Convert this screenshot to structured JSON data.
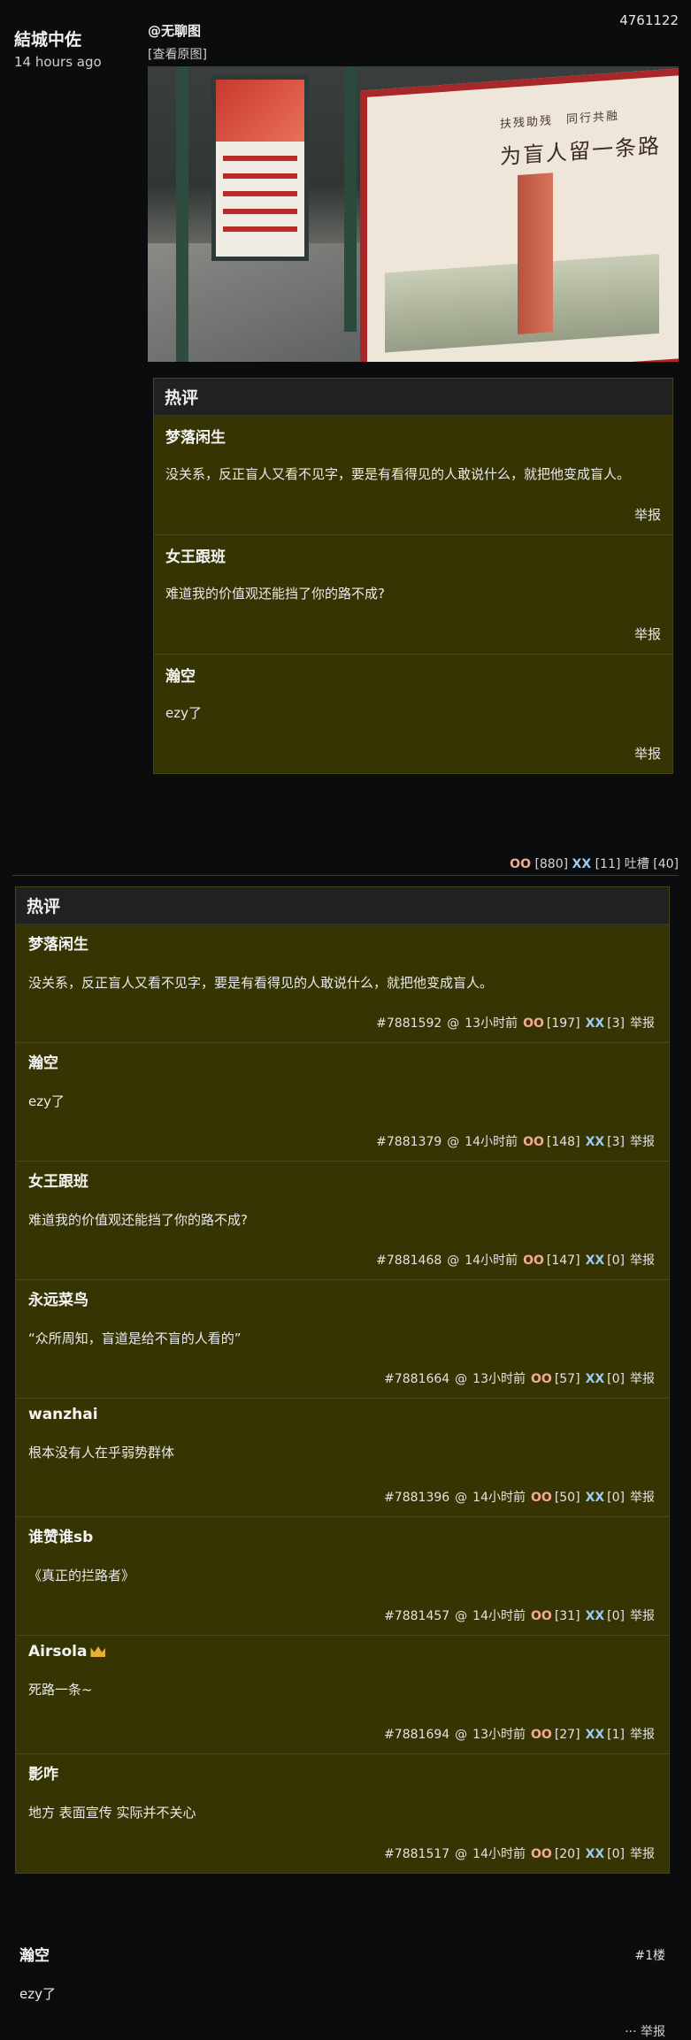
{
  "post": {
    "author": "結城中佐",
    "time": "14 hours ago",
    "id": "4761122",
    "source": "@无聊图",
    "view_original": "[查看原图]",
    "image_slogan_top": "扶残助残　同行共融",
    "image_slogan_main": "为盲人留一条路"
  },
  "hot_inline": {
    "title": "热评",
    "comments": [
      {
        "name": "梦落闲生",
        "text": "没关系，反正盲人又看不见字，要是有看得见的人敢说什么，就把他变成盲人。",
        "report": "举报"
      },
      {
        "name": "女王跟班",
        "text": "难道我的价值观还能挡了你的路不成?",
        "report": "举报"
      },
      {
        "name": "瀚空",
        "text": "ezy了",
        "report": "举报"
      }
    ]
  },
  "post_votes": {
    "oo_label": "OO",
    "oo_count": "[880]",
    "xx_label": "XX",
    "xx_count": "[11]",
    "tucao_label": "吐槽",
    "tucao_count": "[40]"
  },
  "hot_list": {
    "title": "热评",
    "comments": [
      {
        "name": "梦落闲生",
        "text": "没关系，反正盲人又看不见字，要是有看得见的人敢说什么，就把他变成盲人。",
        "id": "#7881592",
        "at": "@",
        "time": "13小时前",
        "oo": "[197]",
        "xx": "[3]",
        "report": "举报",
        "crown": false
      },
      {
        "name": "瀚空",
        "text": "ezy了",
        "id": "#7881379",
        "at": "@",
        "time": "14小时前",
        "oo": "[148]",
        "xx": "[3]",
        "report": "举报",
        "crown": false
      },
      {
        "name": "女王跟班",
        "text": "难道我的价值观还能挡了你的路不成?",
        "id": "#7881468",
        "at": "@",
        "time": "14小时前",
        "oo": "[147]",
        "xx": "[0]",
        "report": "举报",
        "crown": false
      },
      {
        "name": "永远菜鸟",
        "text": "“众所周知，盲道是给不盲的人看的”",
        "id": "#7881664",
        "at": "@",
        "time": "13小时前",
        "oo": "[57]",
        "xx": "[0]",
        "report": "举报",
        "crown": false
      },
      {
        "name": "wanzhai",
        "text": "根本没有人在乎弱势群体",
        "id": "#7881396",
        "at": "@",
        "time": "14小时前",
        "oo": "[50]",
        "xx": "[0]",
        "report": "举报",
        "crown": false
      },
      {
        "name": "谁赞谁sb",
        "text": "《真正的拦路者》",
        "id": "#7881457",
        "at": "@",
        "time": "14小时前",
        "oo": "[31]",
        "xx": "[0]",
        "report": "举报",
        "crown": false
      },
      {
        "name": "Airsola",
        "text": "死路一条~",
        "id": "#7881694",
        "at": "@",
        "time": "13小时前",
        "oo": "[27]",
        "xx": "[1]",
        "report": "举报",
        "crown": true
      },
      {
        "name": "影咋",
        "text": "地方 表面宣传 实际并不关心",
        "id": "#7881517",
        "at": "@",
        "time": "14小时前",
        "oo": "[20]",
        "xx": "[0]",
        "report": "举报",
        "crown": false
      }
    ]
  },
  "vote_labels": {
    "oo": "OO",
    "xx": "XX"
  },
  "reply": {
    "name": "瀚空",
    "floor": "#1楼",
    "text": "ezy了",
    "meta": "··· 举报"
  }
}
